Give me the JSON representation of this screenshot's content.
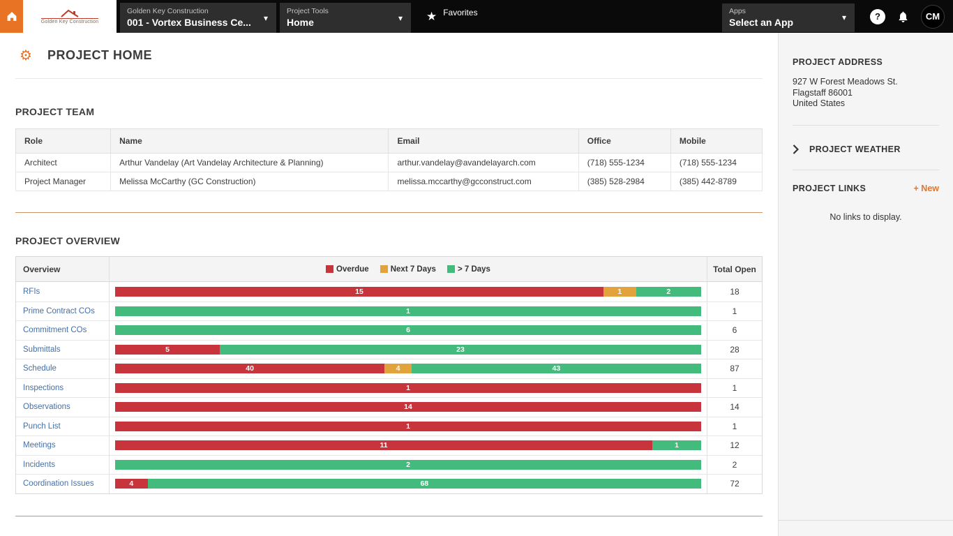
{
  "header": {
    "logo_text": "Golden Key Construction",
    "company": {
      "label": "Golden Key Construction",
      "value": "001 - Vortex Business Ce..."
    },
    "tools": {
      "label": "Project Tools",
      "value": "Home"
    },
    "favorites_label": "Favorites",
    "apps": {
      "label": "Apps",
      "value": "Select an App"
    },
    "help_glyph": "?",
    "avatar_initials": "CM",
    "icons": {
      "gear": "⚙",
      "star": "★",
      "caret": "▾"
    }
  },
  "page": {
    "title": "PROJECT HOME"
  },
  "team": {
    "heading": "PROJECT TEAM",
    "columns": [
      "Role",
      "Name",
      "Email",
      "Office",
      "Mobile"
    ],
    "rows": [
      [
        "Architect",
        "Arthur Vandelay (Art Vandelay Architecture & Planning)",
        "arthur.vandelay@avandelayarch.com",
        "(718) 555-1234",
        "(718) 555-1234"
      ],
      [
        "Project Manager",
        "Melissa McCarthy (GC Construction)",
        "melissa.mccarthy@gcconstruct.com",
        "(385) 528-2984",
        "(385) 442-8789"
      ]
    ]
  },
  "overview": {
    "heading": "PROJECT OVERVIEW"
  },
  "chart_data": {
    "type": "bar",
    "orientation": "horizontal",
    "stacked": true,
    "row_header_label": "Overview",
    "total_column_label": "Total Open",
    "categories": [
      "RFIs",
      "Prime Contract COs",
      "Commitment COs",
      "Submittals",
      "Schedule",
      "Inspections",
      "Observations",
      "Punch List",
      "Meetings",
      "Incidents",
      "Coordination Issues"
    ],
    "series": [
      {
        "name": "Overdue",
        "color": "#c8343b",
        "values": [
          15,
          0,
          0,
          5,
          40,
          1,
          14,
          1,
          11,
          0,
          4
        ]
      },
      {
        "name": "Next 7 Days",
        "color": "#e2a33d",
        "values": [
          1,
          0,
          0,
          0,
          4,
          0,
          0,
          0,
          0,
          0,
          0
        ]
      },
      {
        "name": "> 7 Days",
        "color": "#43bb7c",
        "values": [
          2,
          1,
          6,
          23,
          43,
          0,
          0,
          0,
          1,
          2,
          68
        ]
      }
    ],
    "totals": [
      18,
      1,
      6,
      28,
      87,
      1,
      14,
      1,
      12,
      2,
      72
    ]
  },
  "sidebar": {
    "address": {
      "heading": "PROJECT ADDRESS",
      "lines": [
        "927 W Forest Meadows St.",
        "Flagstaff 86001",
        "United States"
      ]
    },
    "weather": {
      "heading": "PROJECT WEATHER"
    },
    "links": {
      "heading": "PROJECT LINKS",
      "new_label": "+ New",
      "empty_text": "No links to display."
    }
  },
  "colors": {
    "accent_orange": "#e87325",
    "overdue_red": "#c8343b",
    "next7_amber": "#e2a33d",
    "gt7_green": "#43bb7c",
    "link_blue": "#4470a8",
    "navbar_black": "#0a0a0a"
  }
}
